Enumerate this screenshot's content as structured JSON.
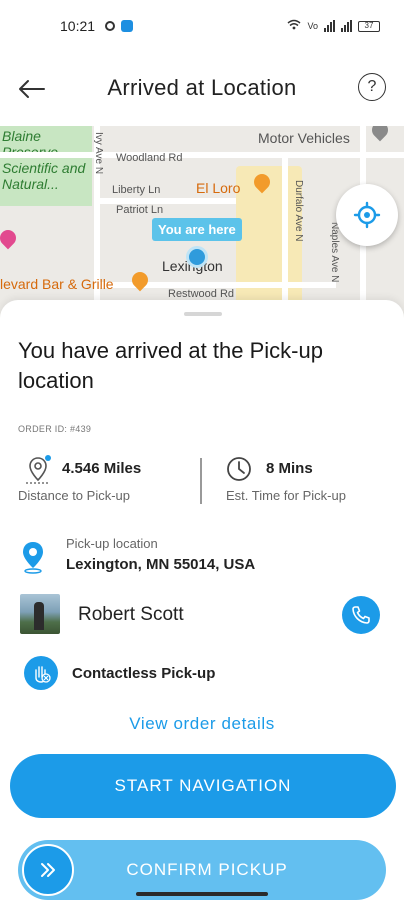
{
  "status_bar": {
    "time": "10:21",
    "battery": "37"
  },
  "header": {
    "title": "Arrived at Location",
    "help_label": "?"
  },
  "map": {
    "park_text": "Blaine Preserve Scientific and Natural...",
    "labels": {
      "woodland": "Woodland Rd",
      "liberty": "Liberty Ln",
      "patriot": "Patriot Ln",
      "restwood": "Restwood Rd",
      "lexington": "Lexington",
      "durfalo": "Durfalo Ave N",
      "naples": "Naples Ave N",
      "ivy": "Ivy Ave N",
      "motor": "Motor Vehicles"
    },
    "poi": {
      "el_loro": "El Loro",
      "boulevard": "levard Bar & Grille"
    },
    "you_are_here": "You are here"
  },
  "sheet": {
    "title": "You have arrived at the Pick-up location",
    "order_id": "ORDER ID: #439",
    "distance": {
      "value": "4.546 Miles",
      "label": "Distance to Pick-up"
    },
    "time": {
      "value": "8 Mins",
      "label": "Est. Time for Pick-up"
    },
    "pickup": {
      "label": "Pick-up location",
      "address": "Lexington, MN 55014, USA"
    },
    "customer": {
      "name": "Robert Scott"
    },
    "contactless": "Contactless Pick-up",
    "view_details": "View order details",
    "start_navigation": "START NAVIGATION",
    "confirm_pickup": "CONFIRM PICKUP"
  },
  "colors": {
    "accent": "#1c9be8",
    "accent_light": "#63bff0"
  }
}
